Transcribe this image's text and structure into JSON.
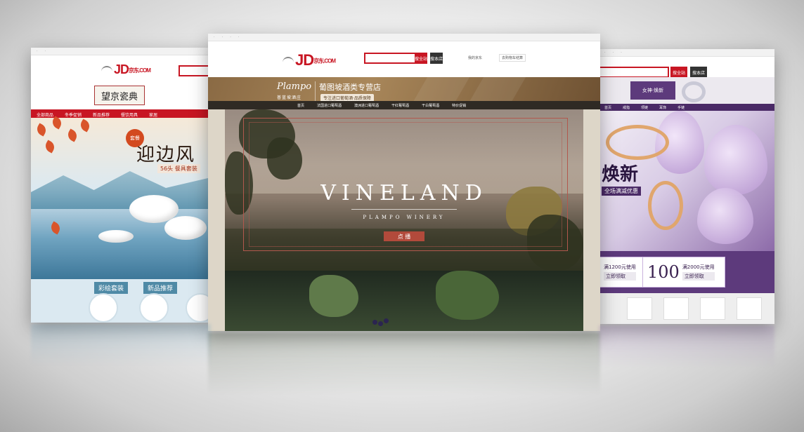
{
  "left_page": {
    "logo": "JD",
    "logo_cn": "京东",
    "logo_com": ".COM",
    "store_name": "望京瓷典",
    "nav": [
      "全部商品",
      "冬季促销",
      "新品推荐",
      "餐饮用具",
      "家居"
    ],
    "poster_badge": "套餐",
    "poster_title": "迎边风",
    "poster_sub": "56头 餐具套装",
    "categories": [
      "彩绘套装",
      "新品推荐"
    ]
  },
  "center_page": {
    "logo": "JD",
    "logo_cn": "京东",
    "logo_com": ".COM",
    "search_button": "搜全站",
    "shop_button": "搜本店",
    "cart": "去购物车结算",
    "my_jd": "我的京东",
    "brand_script": "Plampo",
    "brand_cn": "普蓝坡酒庄",
    "store_title": "葡图坡酒类专营店",
    "store_tag": "专注进口葡萄酒·品质保障",
    "nav": [
      "首页",
      "法国进口葡萄酒",
      "澳洲进口葡萄酒",
      "干红葡萄酒",
      "干白葡萄酒",
      "特价促销"
    ],
    "hero_title": "VINELAND",
    "hero_sub": "PLAMPO WINERY",
    "hero_button": "点 播"
  },
  "right_page": {
    "search_button": "搜全站",
    "shop_button": "搜本店",
    "promo": "女神·焕新",
    "nav": [
      "首页",
      "戒指",
      "项链",
      "耳饰",
      "手链"
    ],
    "hero_title": "焕新",
    "hero_sub": "全场满减优惠",
    "coupons": [
      {
        "amount": "",
        "text": "满1200元使用",
        "use": "立即领取"
      },
      {
        "amount": "100",
        "text": "满2000元使用",
        "use": "立即领取"
      }
    ]
  }
}
